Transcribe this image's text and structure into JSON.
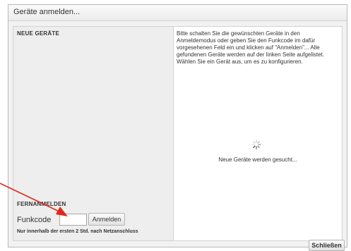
{
  "dialog": {
    "title": "Geräte anmelden..."
  },
  "left_panel": {
    "heading": "NEUE GERÄTE",
    "remote_heading": "FERNANMELDEN",
    "funkcode_label": "Funkcode",
    "funkcode_value": "",
    "anmelden_label": "Anmelden",
    "hint": "Nur innerhalb der ersten 2 Std. nach Netzanschluss"
  },
  "right_panel": {
    "instructions": "Bitte schalten Sie die gewünschten Geräte in den Anmeldemodus oder geben Sie den Funkcode im dafür vorgesehenen Feld ein und klicken auf \"Anmelden\"... Alle gefundenen Geräte werden auf der linken Seite aufgelistet. Wählen Sie ein Gerät aus, um es zu konfigurieren.",
    "status": "Neue Geräte werden gesucht...",
    "spinner_icon": "loading-spinner-icon"
  },
  "footer": {
    "close_label": "Schließen"
  },
  "annotation": {
    "arrow_icon": "red-arrow-icon",
    "arrow_color": "#e3261b"
  }
}
